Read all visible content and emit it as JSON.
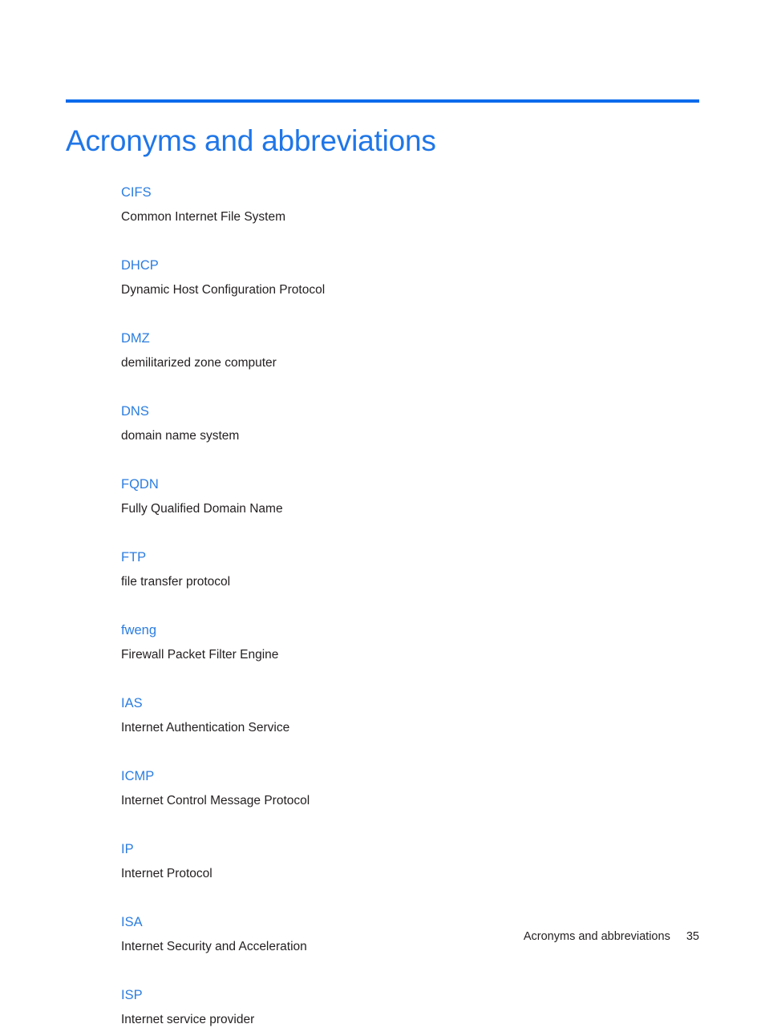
{
  "document": {
    "heading": "Acronyms and abbreviations",
    "accent_color": "#0a6bec",
    "title_color": "#1f76e8",
    "term_color": "#2b7de0",
    "body_color": "#231f20"
  },
  "glossary": {
    "entries": [
      {
        "term": "CIFS",
        "definition": "Common Internet File System"
      },
      {
        "term": "DHCP",
        "definition": "Dynamic Host Configuration Protocol"
      },
      {
        "term": "DMZ",
        "definition": "demilitarized zone computer"
      },
      {
        "term": "DNS",
        "definition": "domain name system"
      },
      {
        "term": "FQDN",
        "definition": "Fully Qualified Domain Name"
      },
      {
        "term": "FTP",
        "definition": "file transfer protocol"
      },
      {
        "term": "fweng",
        "definition": "Firewall Packet Filter Engine"
      },
      {
        "term": "IAS",
        "definition": "Internet Authentication Service"
      },
      {
        "term": "ICMP",
        "definition": "Internet Control Message Protocol"
      },
      {
        "term": "IP",
        "definition": "Internet Protocol"
      },
      {
        "term": "ISA",
        "definition": "Internet Security and Acceleration"
      },
      {
        "term": "ISP",
        "definition": "Internet service provider"
      }
    ]
  },
  "footer": {
    "label": "Acronyms and abbreviations",
    "page_number": "35"
  }
}
